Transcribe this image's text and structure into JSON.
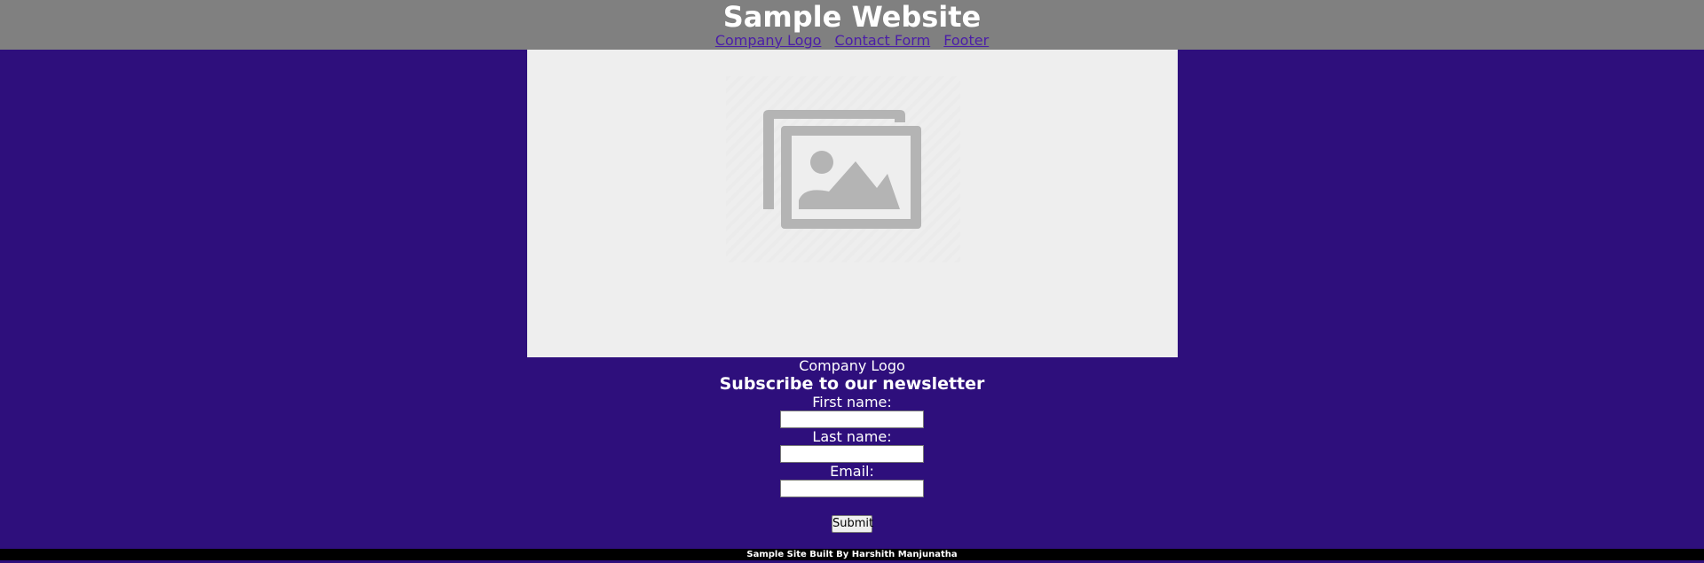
{
  "header": {
    "title": "Sample Website",
    "nav": [
      {
        "label": "Company Logo"
      },
      {
        "label": "Contact Form"
      },
      {
        "label": "Footer"
      }
    ]
  },
  "hero": {
    "icon": "image-placeholder-icon",
    "caption": "Company Logo"
  },
  "newsletter": {
    "heading": "Subscribe to our newsletter",
    "fields": [
      {
        "label": "First name:",
        "value": ""
      },
      {
        "label": "Last name:",
        "value": ""
      },
      {
        "label": "Email:",
        "value": ""
      }
    ],
    "submit_label": "Submit"
  },
  "footer": {
    "text": "Sample Site Built By Harshith Manjunatha"
  },
  "colors": {
    "page_background": "#2e0f7c",
    "header_background": "#808080",
    "link": "#4b1ea8",
    "footer_background": "#000000"
  }
}
